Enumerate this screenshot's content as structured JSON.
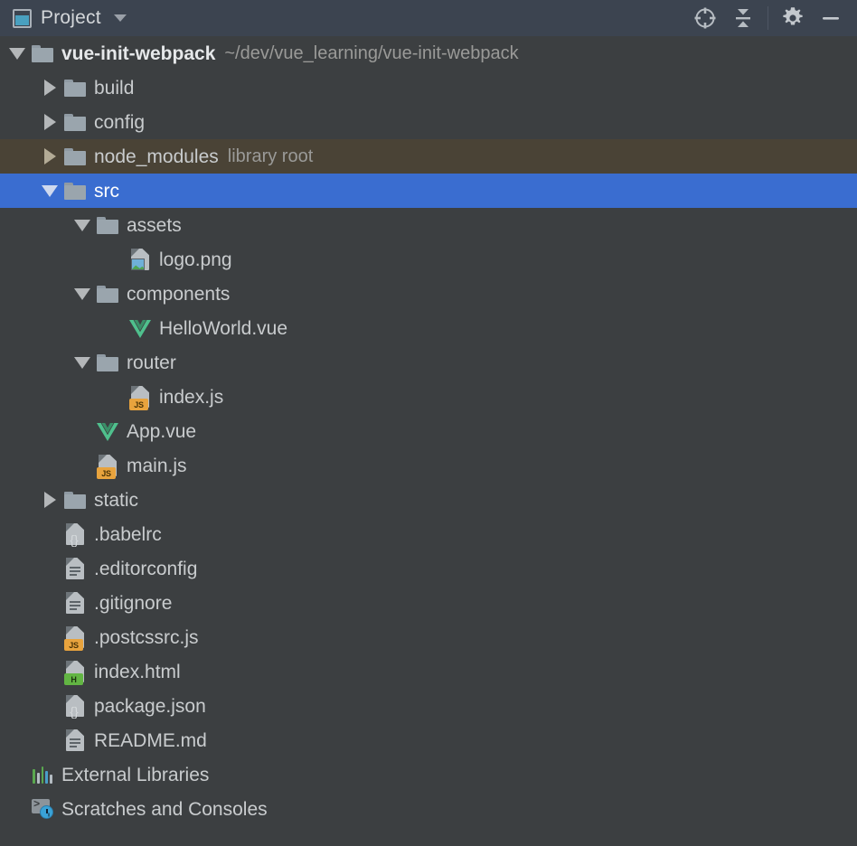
{
  "toolwindow": {
    "title": "Project",
    "title_icon": "project-window-icon",
    "dropdown_icon": "chevron-down-icon",
    "actions": [
      {
        "name": "select-opened-file-button",
        "icon": "crosshair-target-icon",
        "tooltip": "Select Opened File"
      },
      {
        "name": "collapse-all-button",
        "icon": "collapse-all-icon",
        "tooltip": "Collapse All"
      },
      {
        "name": "settings-button",
        "icon": "gear-icon",
        "tooltip": "Settings"
      },
      {
        "name": "hide-button",
        "icon": "minimize-icon",
        "tooltip": "Hide"
      }
    ]
  },
  "colors": {
    "header_bg": "#3c4450",
    "tree_bg": "#3c3f41",
    "selection": "#3a6dd0",
    "library_row": "#4a4336",
    "text": "#c9ccce",
    "text_muted": "#9a9a98",
    "folder": "#9aa5ad",
    "vue_green": "#4fc08d",
    "js_badge": "#e8a33d",
    "html_badge": "#62b543"
  },
  "tree": {
    "rows": [
      {
        "label": "vue-init-webpack",
        "suffix": "~/dev/vue_learning/vue-init-webpack",
        "depth": 0,
        "twisty": "down",
        "icon": "folder",
        "state": "root"
      },
      {
        "label": "build",
        "suffix": "",
        "depth": 1,
        "twisty": "right",
        "icon": "folder",
        "state": ""
      },
      {
        "label": "config",
        "suffix": "",
        "depth": 1,
        "twisty": "right",
        "icon": "folder",
        "state": ""
      },
      {
        "label": "node_modules",
        "suffix": "library root",
        "depth": 1,
        "twisty": "right",
        "icon": "folder",
        "state": "library"
      },
      {
        "label": "src",
        "suffix": "",
        "depth": 1,
        "twisty": "down",
        "icon": "folder",
        "state": "selected"
      },
      {
        "label": "assets",
        "suffix": "",
        "depth": 2,
        "twisty": "down",
        "icon": "folder",
        "state": ""
      },
      {
        "label": "logo.png",
        "suffix": "",
        "depth": 3,
        "twisty": "none",
        "icon": "image",
        "state": ""
      },
      {
        "label": "components",
        "suffix": "",
        "depth": 2,
        "twisty": "down",
        "icon": "folder",
        "state": ""
      },
      {
        "label": "HelloWorld.vue",
        "suffix": "",
        "depth": 3,
        "twisty": "none",
        "icon": "vue",
        "state": ""
      },
      {
        "label": "router",
        "suffix": "",
        "depth": 2,
        "twisty": "down",
        "icon": "folder",
        "state": ""
      },
      {
        "label": "index.js",
        "suffix": "",
        "depth": 3,
        "twisty": "none",
        "icon": "js",
        "state": ""
      },
      {
        "label": "App.vue",
        "suffix": "",
        "depth": 2,
        "twisty": "none",
        "icon": "vue",
        "state": ""
      },
      {
        "label": "main.js",
        "suffix": "",
        "depth": 2,
        "twisty": "none",
        "icon": "js",
        "state": ""
      },
      {
        "label": "static",
        "suffix": "",
        "depth": 1,
        "twisty": "right",
        "icon": "folder",
        "state": ""
      },
      {
        "label": ".babelrc",
        "suffix": "",
        "depth": 1,
        "twisty": "none",
        "icon": "json",
        "state": ""
      },
      {
        "label": ".editorconfig",
        "suffix": "",
        "depth": 1,
        "twisty": "none",
        "icon": "text",
        "state": ""
      },
      {
        "label": ".gitignore",
        "suffix": "",
        "depth": 1,
        "twisty": "none",
        "icon": "text",
        "state": ""
      },
      {
        "label": ".postcssrc.js",
        "suffix": "",
        "depth": 1,
        "twisty": "none",
        "icon": "js",
        "state": ""
      },
      {
        "label": "index.html",
        "suffix": "",
        "depth": 1,
        "twisty": "none",
        "icon": "html",
        "state": ""
      },
      {
        "label": "package.json",
        "suffix": "",
        "depth": 1,
        "twisty": "none",
        "icon": "json",
        "state": ""
      },
      {
        "label": "README.md",
        "suffix": "",
        "depth": 1,
        "twisty": "none",
        "icon": "text",
        "state": ""
      },
      {
        "label": "External Libraries",
        "suffix": "",
        "depth": 0,
        "twisty": "none",
        "icon": "libraries",
        "state": ""
      },
      {
        "label": "Scratches and Consoles",
        "suffix": "",
        "depth": 0,
        "twisty": "none",
        "icon": "scratches",
        "state": ""
      }
    ]
  }
}
